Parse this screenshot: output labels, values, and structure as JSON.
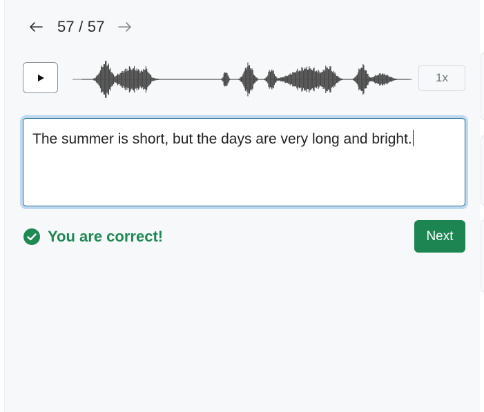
{
  "navigation": {
    "prev_icon": "arrow-left-icon",
    "counter": "57 / 57",
    "next_icon": "arrow-right-icon"
  },
  "player": {
    "play_icon": "play-icon",
    "speed_label": "1x"
  },
  "answer": {
    "text": "The summer is short, but the days are very long and bright."
  },
  "feedback": {
    "icon": "check-circle-icon",
    "message": "You are correct!",
    "color": "#1d8a52"
  },
  "actions": {
    "next_label": "Next",
    "next_color": "#1c8552"
  }
}
